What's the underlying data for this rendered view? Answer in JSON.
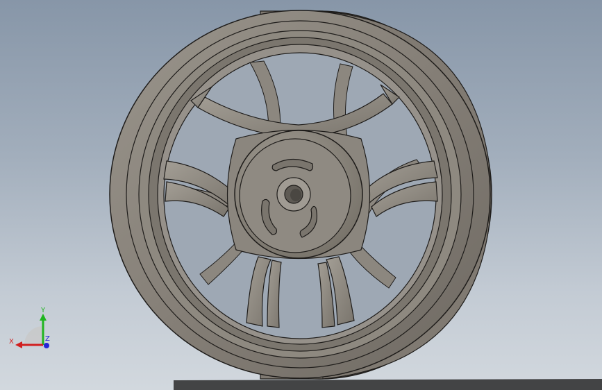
{
  "viewport": {
    "background_top": "#8796a8",
    "background_bottom": "#d2d8de",
    "model": {
      "name": "wheel-rim",
      "spoke_pairs": 5,
      "hub_slots": 3,
      "body_color": "#8a857d",
      "edge_color": "#1e1c1a"
    }
  },
  "triad": {
    "x_label": "X",
    "y_label": "Y",
    "z_label": "Z",
    "x_color": "#d11f1f",
    "y_color": "#1fb51f",
    "z_color": "#2424d6"
  }
}
